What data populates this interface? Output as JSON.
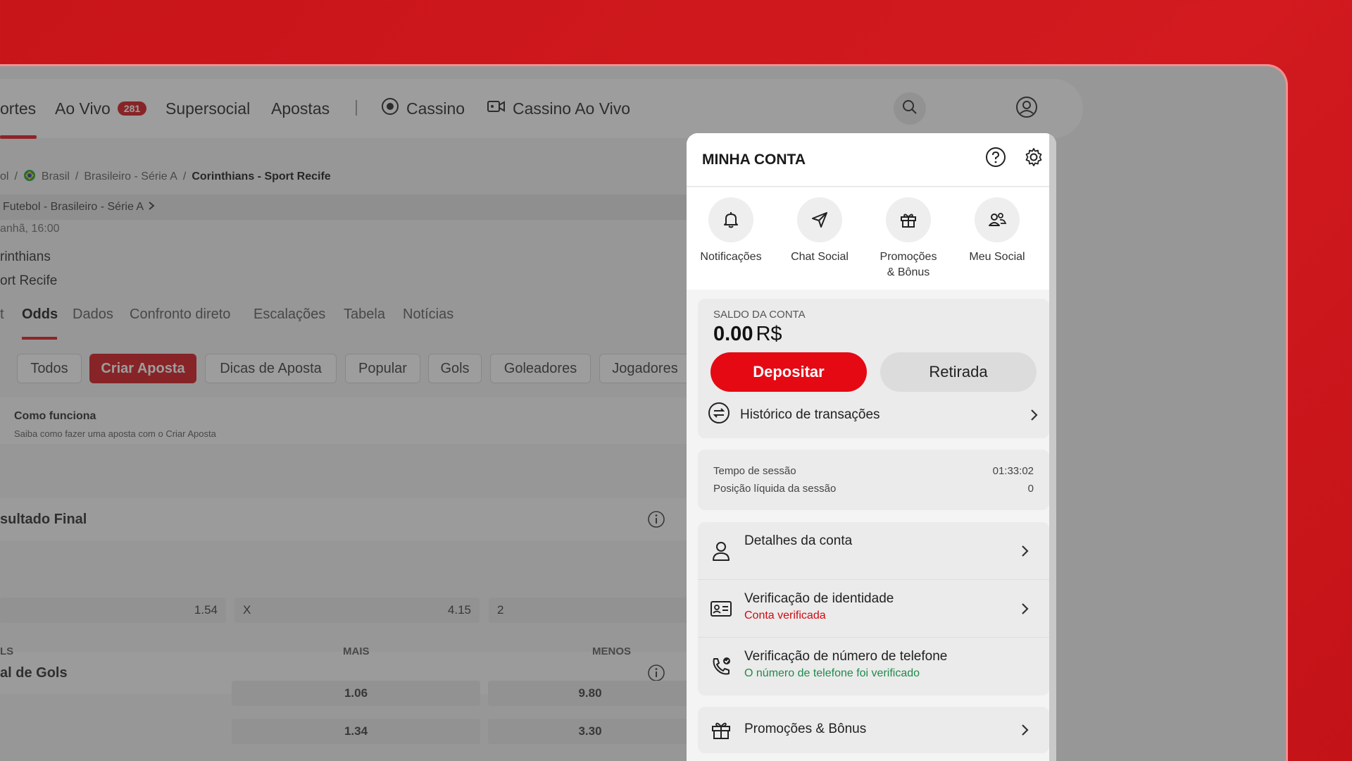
{
  "nav": {
    "items": [
      {
        "label": "ortes"
      },
      {
        "label": "Ao Vivo",
        "badge": "281"
      },
      {
        "label": "Supersocial"
      },
      {
        "label": "Apostas"
      },
      {
        "label": "Cassino"
      },
      {
        "label": "Cassino Ao Vivo"
      }
    ]
  },
  "breadcrumb": {
    "items": [
      "ol",
      "Brasil",
      "Brasileiro - Série A"
    ],
    "current": "Corinthians - Sport Recife"
  },
  "match": {
    "strip": "Futebol - Brasileiro - Série A",
    "time": "anhã, 16:00",
    "team1": "rinthians",
    "team2": "ort Recife"
  },
  "subtabs": [
    "t",
    "Odds",
    "Dados",
    "Confronto direto",
    "Escalações",
    "Tabela",
    "Notícias"
  ],
  "chips": [
    "Todos",
    "Criar Aposta",
    "Dicas de Aposta",
    "Popular",
    "Gols",
    "Goleadores",
    "Jogadores"
  ],
  "how": {
    "title": "Como funciona",
    "subtitle": "Saiba como fazer uma aposta com o Criar Aposta"
  },
  "markets": {
    "result": {
      "title": "sultado Final",
      "odds": [
        {
          "label": "",
          "value": "1.54"
        },
        {
          "label": "X",
          "value": "4.15"
        },
        {
          "label": "2",
          "value": ""
        }
      ]
    },
    "goals": {
      "title": "al de Gols",
      "col_left": "LS",
      "col_mais": "MAIS",
      "col_menos": "MENOS",
      "rows": [
        {
          "mais": "1.06",
          "menos": "9.80"
        },
        {
          "mais": "1.34",
          "menos": "3.30"
        }
      ]
    }
  },
  "panel": {
    "title": "MINHA CONTA",
    "quick": [
      {
        "icon": "bell-icon",
        "label": "Notificações"
      },
      {
        "icon": "send-icon",
        "label": "Chat Social"
      },
      {
        "icon": "gift-icon",
        "label": "Promoções\n& Bônus"
      },
      {
        "icon": "users-icon",
        "label": "Meu Social"
      }
    ],
    "balance": {
      "title": "SALDO DA CONTA",
      "amount": "0.00",
      "currency": "R$",
      "deposit": "Depositar",
      "withdraw": "Retirada",
      "history": "Histórico de transações"
    },
    "session": {
      "time_label": "Tempo de sessão",
      "time_value": "01:33:02",
      "net_label": "Posição líquida da sessão",
      "net_value": "0"
    },
    "rows": [
      {
        "title": "Detalhes da conta",
        "sub": ""
      },
      {
        "title": "Verificação de identidade",
        "sub": "Conta verificada"
      },
      {
        "title": "Verificação de número de telefone",
        "sub": "O número de telefone foi verificado"
      }
    ],
    "promo": "Promoções & Bônus"
  },
  "colors": {
    "brand_red": "#e50914",
    "verified_red": "#d10a12",
    "verified_green": "#1f8a4c"
  }
}
